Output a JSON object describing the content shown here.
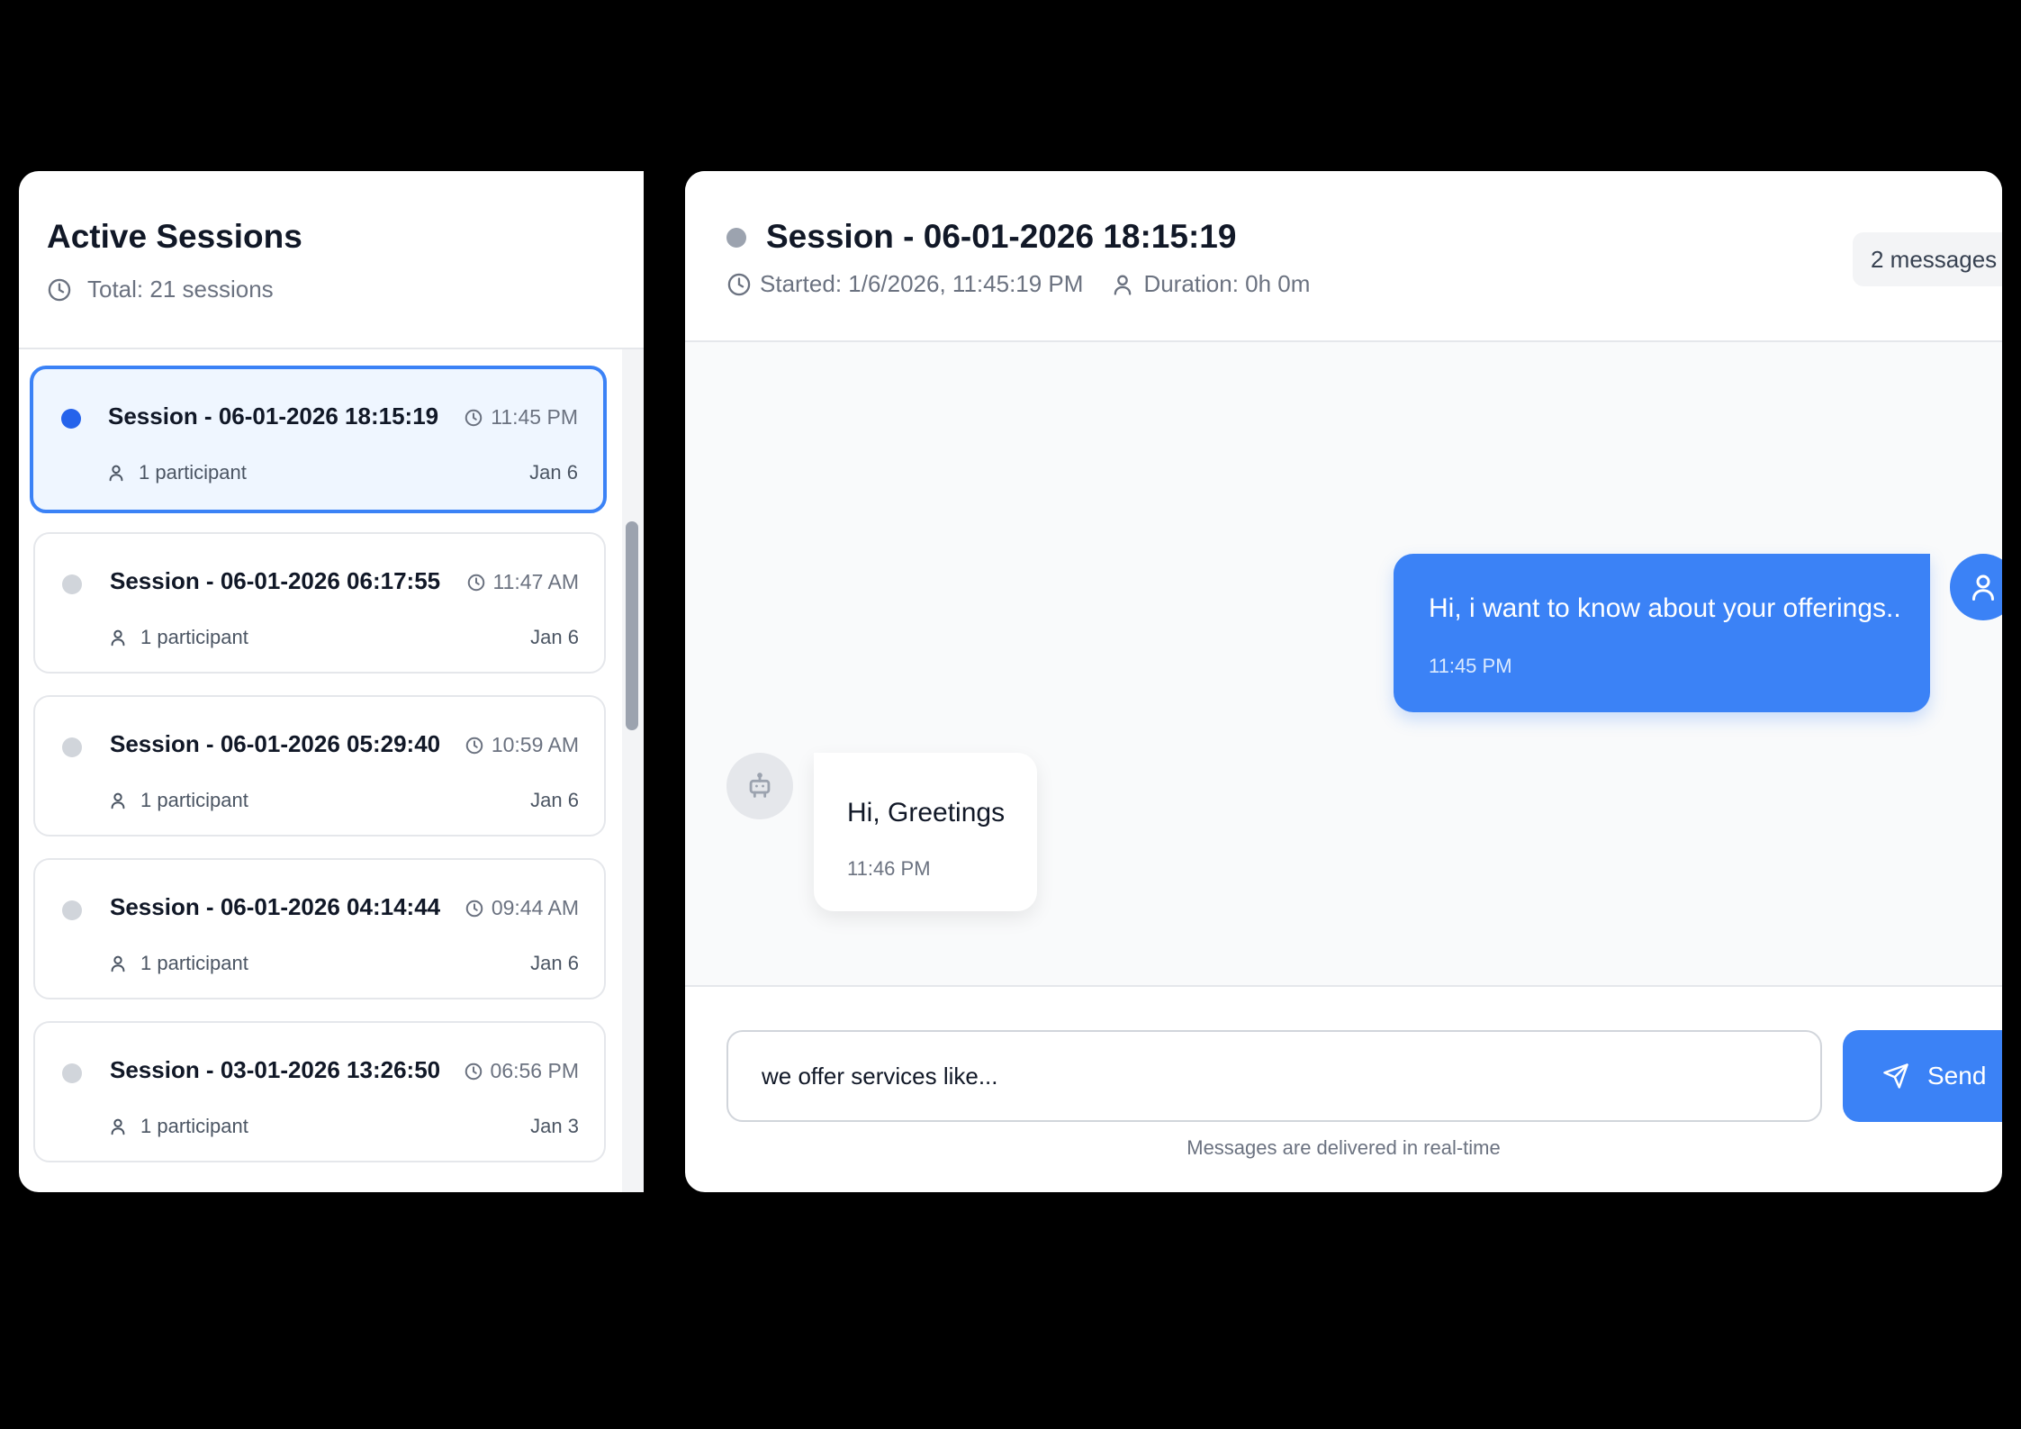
{
  "sessions_panel": {
    "title": "Active Sessions",
    "total": "Total: 21 sessions",
    "items": [
      {
        "name": "Session - 06-01-2026 18:15:19",
        "time": "11:45 PM",
        "participants": "1 participant",
        "date": "Jan 6",
        "active": true
      },
      {
        "name": "Session - 06-01-2026 06:17:55",
        "time": "11:47 AM",
        "participants": "1 participant",
        "date": "Jan 6",
        "active": false
      },
      {
        "name": "Session - 06-01-2026 05:29:40",
        "time": "10:59 AM",
        "participants": "1 participant",
        "date": "Jan 6",
        "active": false
      },
      {
        "name": "Session - 06-01-2026 04:14:44",
        "time": "09:44 AM",
        "participants": "1 participant",
        "date": "Jan 6",
        "active": false
      },
      {
        "name": "Session - 03-01-2026 13:26:50",
        "time": "06:56 PM",
        "participants": "1 participant",
        "date": "Jan 3",
        "active": false
      }
    ]
  },
  "chat": {
    "title": "Session - 06-01-2026 18:15:19",
    "started": "Started: 1/6/2026, 11:45:19 PM",
    "duration": "Duration: 0h 0m",
    "message_count": "2 messages",
    "messages": [
      {
        "sender": "user",
        "text": "Hi, i want to know about your offerings..",
        "time": "11:45 PM"
      },
      {
        "sender": "bot",
        "text": "Hi, Greetings",
        "time": "11:46 PM"
      }
    ],
    "input_value": "we offer services like...",
    "send_label": "Send",
    "delivery_note": "Messages are delivered in real-time"
  },
  "icons": {
    "clock": "clock-icon",
    "user": "user-icon",
    "bot": "bot-icon",
    "send": "send-icon"
  },
  "colors": {
    "accent": "#3b82f6",
    "active_dot": "#2563eb",
    "inactive_dot": "#d1d5db",
    "status_dot": "#9ca3af"
  }
}
